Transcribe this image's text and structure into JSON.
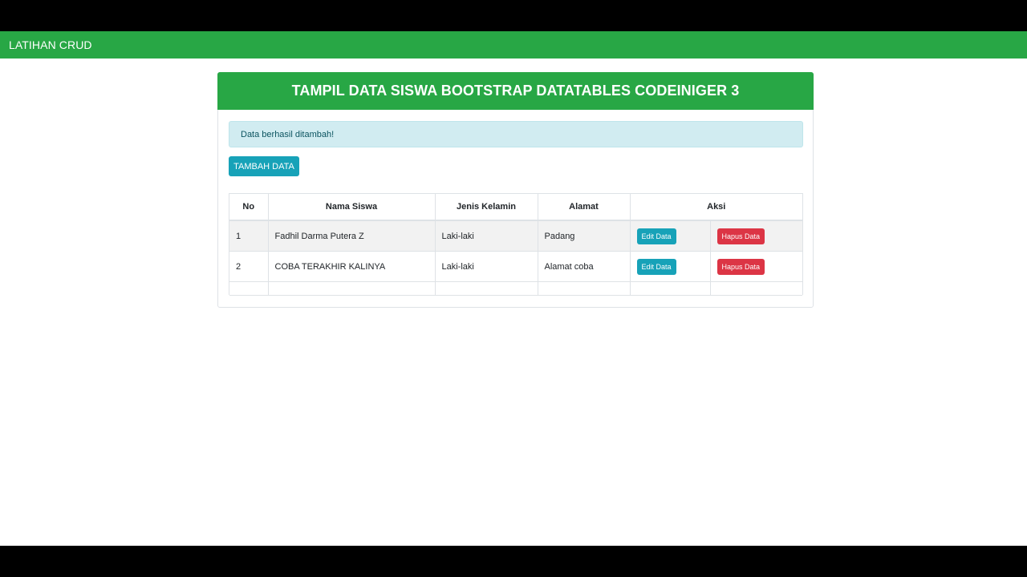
{
  "navbar": {
    "brand": "LATIHAN CRUD",
    "color": "#28a745"
  },
  "card": {
    "title": "TAMPIL DATA SISWA BOOTSTRAP DATATABLES CODEINIGER 3"
  },
  "alert": {
    "message": "Data berhasil ditambah!"
  },
  "add_button": {
    "label": "TAMBAH DATA"
  },
  "table": {
    "headers": [
      "No",
      "Nama Siswa",
      "Jenis Kelamin",
      "Alamat",
      "Aksi"
    ],
    "rows": [
      {
        "no": "1",
        "nama": "Fadhil Darma Putera Z",
        "jenis_kelamin": "Laki-laki",
        "alamat": "Padang",
        "edit_label": "Edit Data",
        "delete_label": "Hapus Data"
      },
      {
        "no": "2",
        "nama": "COBA TERAKHIR KALINYA",
        "jenis_kelamin": "Laki-laki",
        "alamat": "Alamat coba",
        "edit_label": "Edit Data",
        "delete_label": "Hapus Data"
      }
    ]
  },
  "colors": {
    "success": "#28a745",
    "info": "#17a2b8",
    "danger": "#dc3545",
    "alert_bg": "#d1ecf1"
  }
}
